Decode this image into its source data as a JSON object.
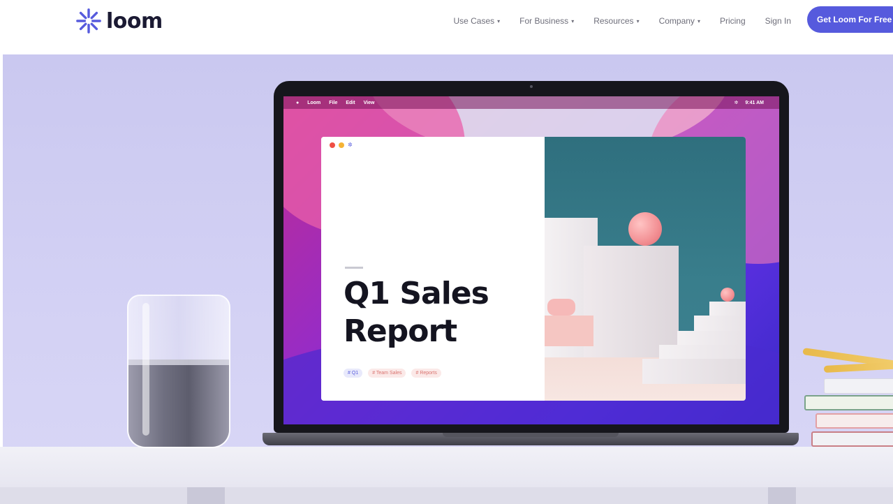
{
  "brand": {
    "name": "loom",
    "logo_icon": "starburst-icon",
    "accent": "#565add"
  },
  "nav": {
    "items": [
      {
        "label": "Use Cases",
        "dropdown": true
      },
      {
        "label": "For Business",
        "dropdown": true
      },
      {
        "label": "Resources",
        "dropdown": true
      },
      {
        "label": "Company",
        "dropdown": true
      },
      {
        "label": "Pricing",
        "dropdown": false
      },
      {
        "label": "Sign In",
        "dropdown": false
      }
    ],
    "cta": "Get Loom For Free"
  },
  "laptop_screen": {
    "menubar": {
      "items": [
        "Loom",
        "File",
        "Edit",
        "View"
      ],
      "clock": "9:41 AM"
    },
    "slide": {
      "title_line1": "Q1 Sales",
      "title_line2": "Report",
      "tags": [
        "# Q1",
        "# Team Sales",
        "# Reports"
      ]
    }
  }
}
